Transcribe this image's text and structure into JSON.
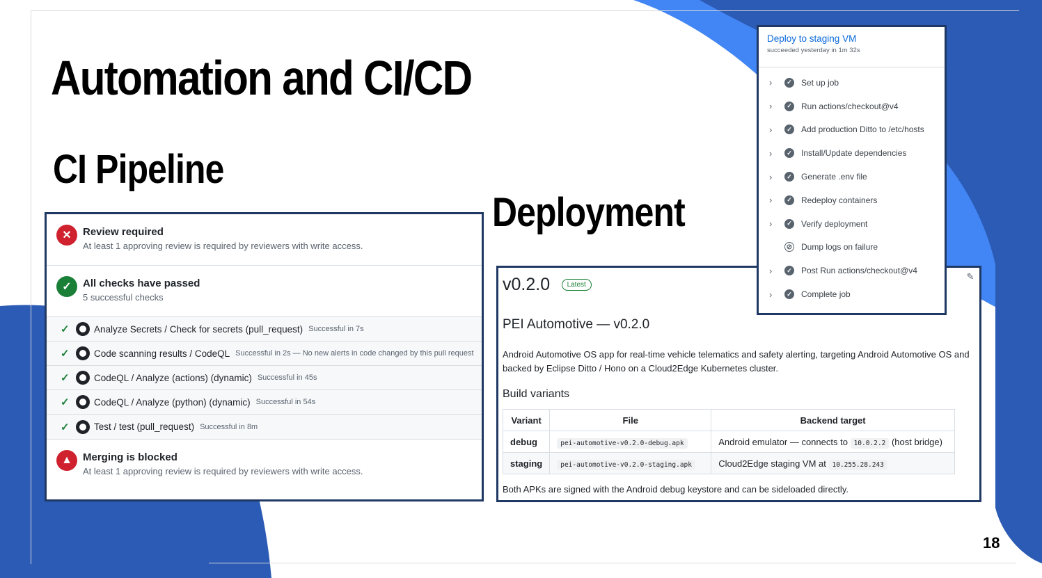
{
  "slide": {
    "title": "Automation and CI/CD",
    "subtitle": "CI Pipeline",
    "deploy_heading": "Deployment",
    "page_number": "18",
    "colors": {
      "dark_blue": "#2b5bb5",
      "bright_blue": "#4285f4",
      "panel_border": "#1f3864"
    }
  },
  "ci": {
    "review": {
      "icon": "x-circle-icon",
      "title": "Review required",
      "desc": "At least 1 approving review is required by reviewers with write access."
    },
    "checks": {
      "icon": "check-circle-icon",
      "title": "All checks have passed",
      "desc": "5 successful checks"
    },
    "items": [
      {
        "name": "Analyze Secrets / Check for secrets (pull_request)",
        "meta": "Successful in 7s"
      },
      {
        "name": "Code scanning results / CodeQL",
        "meta": "Successful in 2s — No new alerts in code changed by this pull request"
      },
      {
        "name": "CodeQL / Analyze (actions) (dynamic)",
        "meta": "Successful in 45s"
      },
      {
        "name": "CodeQL / Analyze (python) (dynamic)",
        "meta": "Successful in 54s"
      },
      {
        "name": "Test / test (pull_request)",
        "meta": "Successful in 8m"
      }
    ],
    "merge": {
      "icon": "alert-triangle-icon",
      "title": "Merging is blocked",
      "desc": "At least 1 approving review is required by reviewers with write access."
    }
  },
  "release": {
    "version": "v0.2.0",
    "badge": "Latest",
    "heading": "PEI Automotive — v0.2.0",
    "description": "Android Automotive OS app for real-time vehicle telematics and safety alerting, targeting Android Automotive OS and backed by Eclipse Ditto / Hono on a Cloud2Edge Kubernetes cluster.",
    "variants_heading": "Build variants",
    "columns": [
      "Variant",
      "File",
      "Backend target"
    ],
    "rows": [
      {
        "variant": "debug",
        "file": "pei-automotive-v0.2.0-debug.apk",
        "target_text": "Android emulator — connects to",
        "target_code": "10.0.2.2",
        "target_suffix": "(host bridge)"
      },
      {
        "variant": "staging",
        "file": "pei-automotive-v0.2.0-staging.apk",
        "target_text": "Cloud2Edge staging VM at",
        "target_code": "10.255.28.243",
        "target_suffix": ""
      }
    ],
    "footer": "Both APKs are signed with the Android debug keystore and can be sideloaded directly."
  },
  "job": {
    "title": "Deploy to staging VM",
    "subtitle": "succeeded yesterday in 1m 32s",
    "steps": [
      {
        "name": "Set up job",
        "status": "success"
      },
      {
        "name": "Run actions/checkout@v4",
        "status": "success"
      },
      {
        "name": "Add production Ditto to /etc/hosts",
        "status": "success"
      },
      {
        "name": "Install/Update dependencies",
        "status": "success"
      },
      {
        "name": "Generate .env file",
        "status": "success"
      },
      {
        "name": "Redeploy containers",
        "status": "success"
      },
      {
        "name": "Verify deployment",
        "status": "success"
      },
      {
        "name": "Dump logs on failure",
        "status": "skipped"
      },
      {
        "name": "Post Run actions/checkout@v4",
        "status": "success"
      },
      {
        "name": "Complete job",
        "status": "success"
      }
    ]
  }
}
